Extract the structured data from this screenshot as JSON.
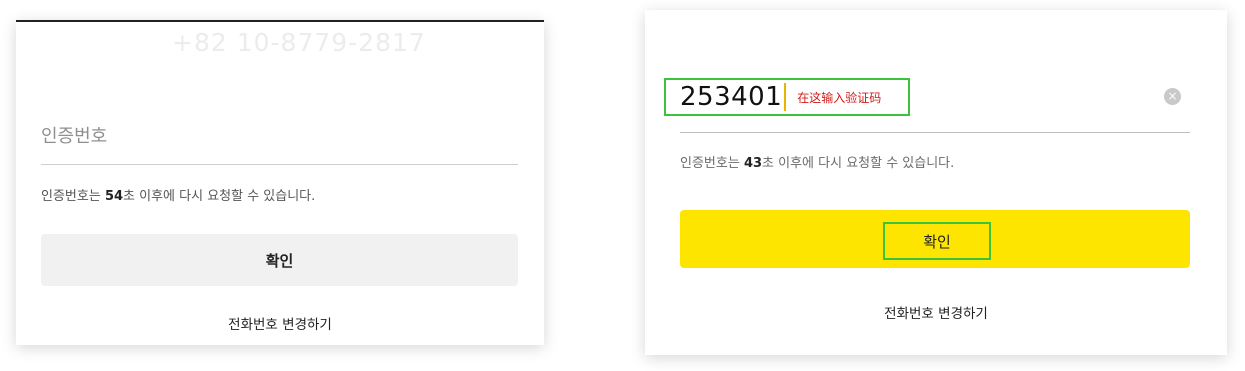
{
  "left_panel": {
    "phone_number_faded": "+82 10-8779-2817",
    "code_input_placeholder": "인증번호",
    "timer": {
      "prefix": "인증번호는 ",
      "seconds": "54",
      "suffix": "초 이후에 다시 요청할 수 있습니다."
    },
    "confirm_label": "확인",
    "change_phone_label": "전화번호 변경하기"
  },
  "right_panel": {
    "code_input_value": "253401",
    "annotation_hint": "在这输入验证码",
    "clear_icon_glyph": "×",
    "timer": {
      "prefix": "인증번호는 ",
      "seconds": "43",
      "suffix": "초 이후에 다시 요청할 수 있습니다."
    },
    "confirm_label": "확인",
    "change_phone_label": "전화번호 변경하기"
  },
  "colors": {
    "confirm_active": "#fee500",
    "confirm_inactive": "#f1f1f1",
    "annotation_outline": "#3bc43b",
    "annotation_text": "#d21a1a"
  }
}
